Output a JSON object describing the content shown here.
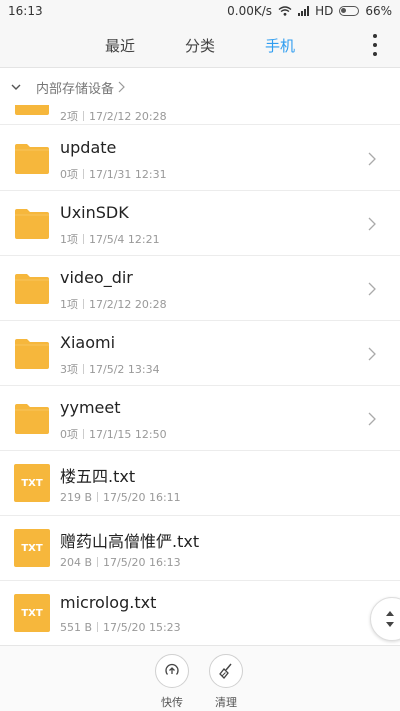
{
  "status_bar": {
    "time": "16:13",
    "net_speed": "0.00K/s",
    "network_type": "HD",
    "battery": "66%"
  },
  "tabs": [
    {
      "label": "最近",
      "active": false
    },
    {
      "label": "分类",
      "active": false
    },
    {
      "label": "手机",
      "active": true
    }
  ],
  "breadcrumb": {
    "label": "内部存储设备"
  },
  "partial_row": {
    "count": "2项",
    "date": "17/2/12 20:28"
  },
  "rows": [
    {
      "type": "folder",
      "name": "update",
      "left": "0项",
      "right": "17/1/31 12:31"
    },
    {
      "type": "folder",
      "name": "UxinSDK",
      "left": "1项",
      "right": "17/5/4 12:21"
    },
    {
      "type": "folder",
      "name": "video_dir",
      "left": "1项",
      "right": "17/2/12 20:28"
    },
    {
      "type": "folder",
      "name": "Xiaomi",
      "left": "3项",
      "right": "17/5/2 13:34"
    },
    {
      "type": "folder",
      "name": "yymeet",
      "left": "0项",
      "right": "17/1/15 12:50"
    },
    {
      "type": "file",
      "name": "楼五四.txt",
      "left": "219 B",
      "right": "17/5/20 16:11",
      "badge": "TXT"
    },
    {
      "type": "file",
      "name": "赠药山高僧惟俨.txt",
      "left": "204 B",
      "right": "17/5/20 16:13",
      "badge": "TXT"
    },
    {
      "type": "file",
      "name": "microlog.txt",
      "left": "551 B",
      "right": "17/5/20 15:23",
      "badge": "TXT"
    }
  ],
  "bottom_actions": [
    {
      "label": "快传",
      "icon": "send-icon"
    },
    {
      "label": "清理",
      "icon": "broom-icon"
    }
  ],
  "colors": {
    "accent": "#2f9df0",
    "folder": "#f6b73c"
  }
}
